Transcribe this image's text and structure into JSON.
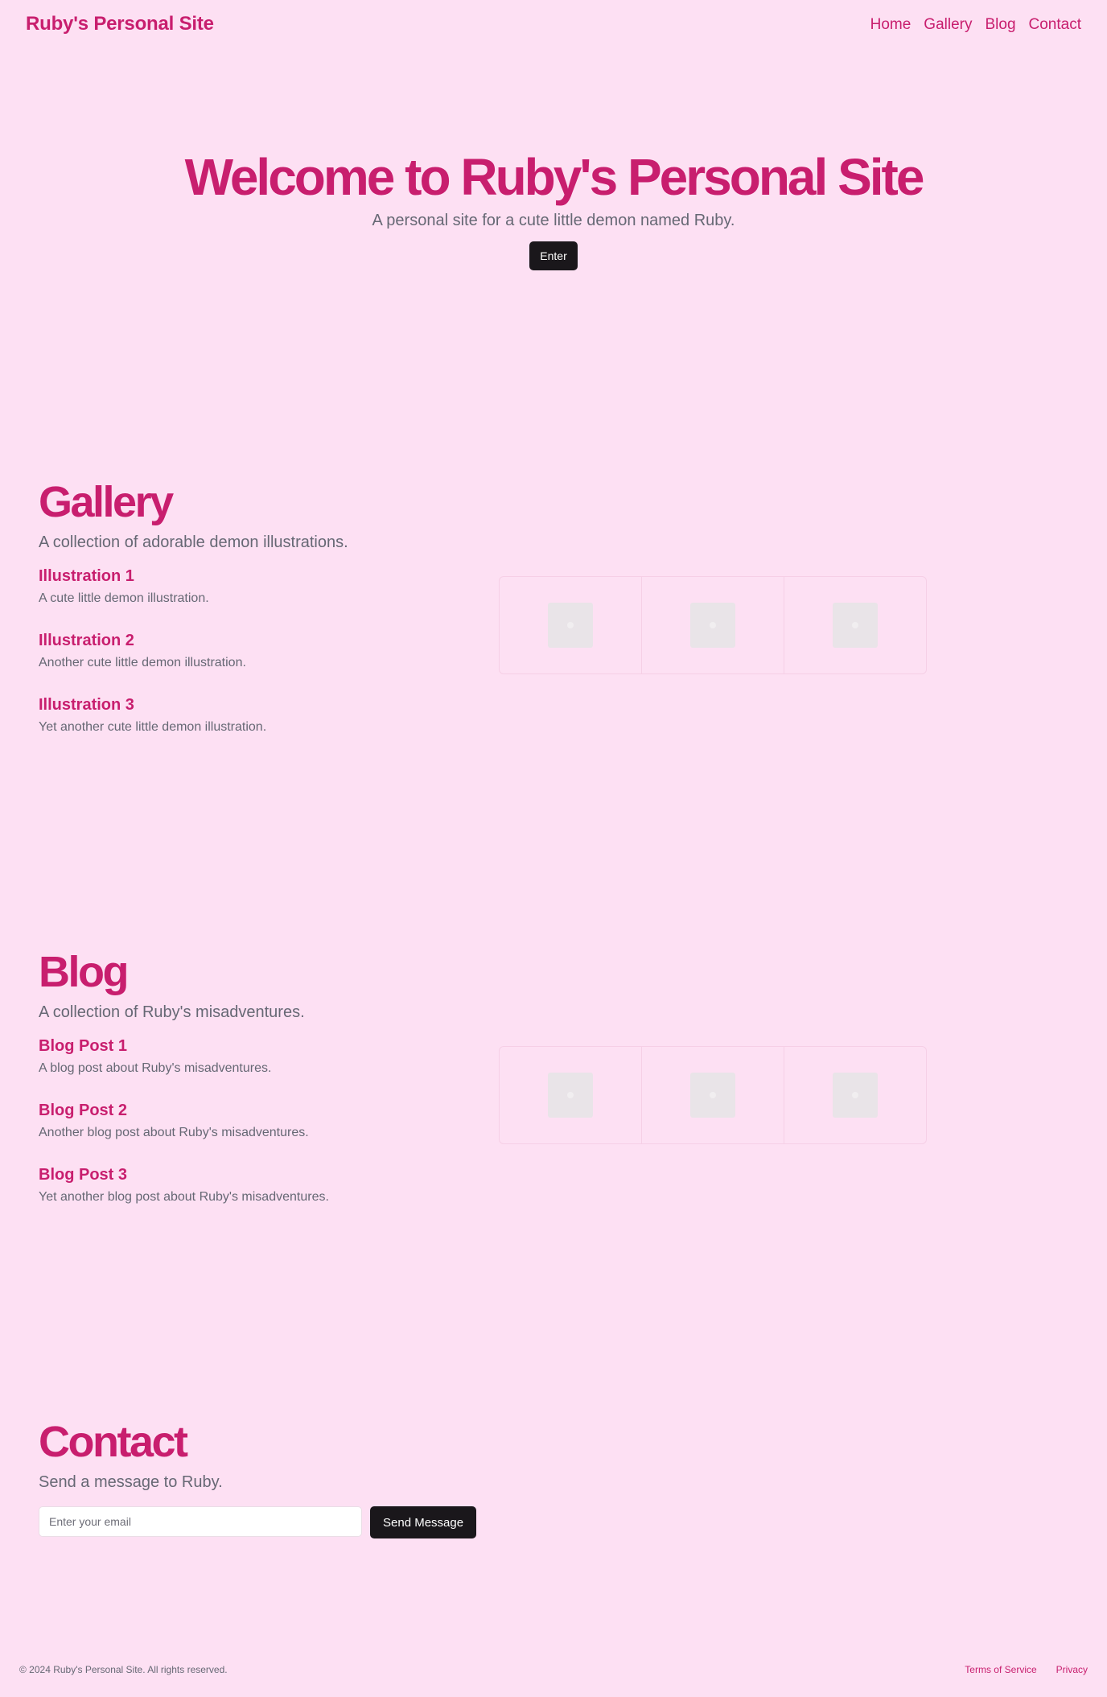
{
  "header": {
    "brand": "Ruby's Personal Site",
    "nav": [
      "Home",
      "Gallery",
      "Blog",
      "Contact"
    ]
  },
  "hero": {
    "title": "Welcome to Ruby's Personal Site",
    "subtitle": "A personal site for a cute little demon named Ruby.",
    "button": "Enter"
  },
  "gallery": {
    "title": "Gallery",
    "subtitle": "A collection of adorable demon illustrations.",
    "items": [
      {
        "title": "Illustration 1",
        "desc": "A cute little demon illustration."
      },
      {
        "title": "Illustration 2",
        "desc": "Another cute little demon illustration."
      },
      {
        "title": "Illustration 3",
        "desc": "Yet another cute little demon illustration."
      }
    ]
  },
  "blog": {
    "title": "Blog",
    "subtitle": "A collection of Ruby's misadventures.",
    "items": [
      {
        "title": "Blog Post 1",
        "desc": "A blog post about Ruby's misadventures."
      },
      {
        "title": "Blog Post 2",
        "desc": "Another blog post about Ruby's misadventures."
      },
      {
        "title": "Blog Post 3",
        "desc": "Yet another blog post about Ruby's misadventures."
      }
    ]
  },
  "contact": {
    "title": "Contact",
    "subtitle": "Send a message to Ruby.",
    "email_placeholder": "Enter your email",
    "button": "Send Message"
  },
  "footer": {
    "copyright": "© 2024 Ruby's Personal Site. All rights reserved.",
    "links": [
      "Terms of Service",
      "Privacy"
    ]
  },
  "colors": {
    "background": "#fde0f3",
    "accent": "#c81e6e",
    "muted_text": "#666874",
    "button_dark": "#1a171b"
  }
}
